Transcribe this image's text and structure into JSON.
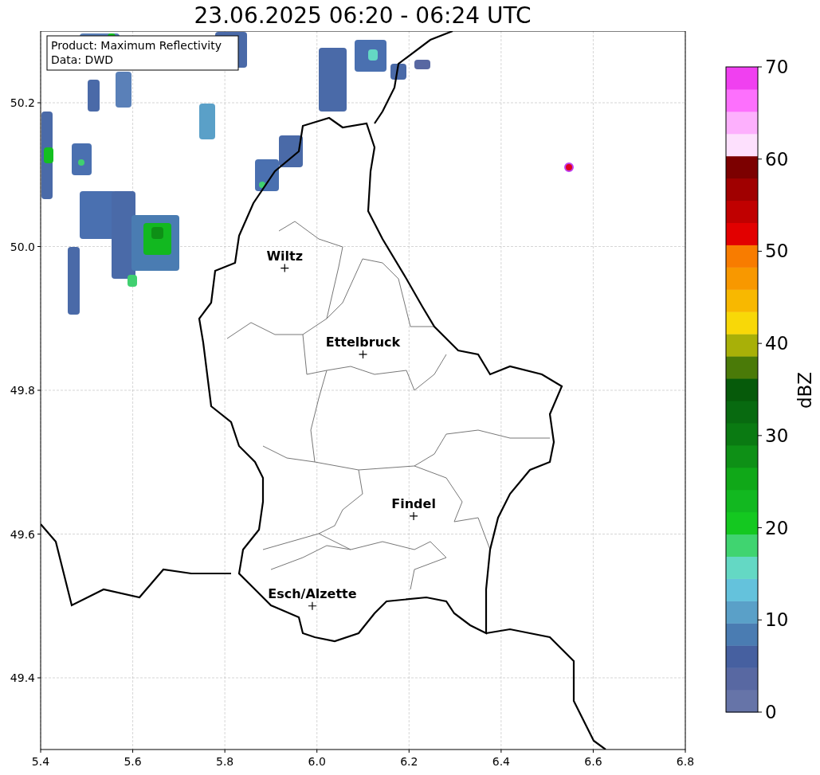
{
  "title": "23.06.2025 06:20 - 06:24 UTC",
  "info_box": {
    "lines": [
      "Product: Maximum Reflectivity",
      "Data: DWD"
    ]
  },
  "map": {
    "x_ticks": [
      "5.4",
      "5.6",
      "5.8",
      "6.0",
      "6.2",
      "6.4",
      "6.6",
      "6.8"
    ],
    "y_ticks": [
      "50.2",
      "50.0",
      "49.8",
      "49.6",
      "49.4"
    ],
    "places": [
      {
        "name": "Wiltz"
      },
      {
        "name": "Ettelbruck"
      },
      {
        "name": "Findel"
      },
      {
        "name": "Esch/Alzette"
      }
    ]
  },
  "colorbar": {
    "label": "dBZ",
    "ticks": [
      "70",
      "60",
      "50",
      "40",
      "30",
      "20",
      "10",
      "0"
    ],
    "bands": [
      {
        "color": "#6674a8"
      },
      {
        "color": "#5868a2"
      },
      {
        "color": "#4660a0"
      },
      {
        "color": "#4a7cb2"
      },
      {
        "color": "#5aa0c8"
      },
      {
        "color": "#64c2dc"
      },
      {
        "color": "#64d8c4"
      },
      {
        "color": "#40d470"
      },
      {
        "color": "#14c820"
      },
      {
        "color": "#12b820"
      },
      {
        "color": "#10a818"
      },
      {
        "color": "#0e9016"
      },
      {
        "color": "#0a7a12"
      },
      {
        "color": "#086a10"
      },
      {
        "color": "#065a0a"
      },
      {
        "color": "#4a7a08"
      },
      {
        "color": "#a8b008"
      },
      {
        "color": "#f8d808"
      },
      {
        "color": "#f8b800"
      },
      {
        "color": "#f89800"
      },
      {
        "color": "#f87c00"
      },
      {
        "color": "#e20000"
      },
      {
        "color": "#c00000"
      },
      {
        "color": "#a00000"
      },
      {
        "color": "#7c0000"
      },
      {
        "color": "#fde0fd"
      },
      {
        "color": "#fdb0fd"
      },
      {
        "color": "#fd70fd"
      },
      {
        "color": "#f040f0"
      }
    ]
  }
}
